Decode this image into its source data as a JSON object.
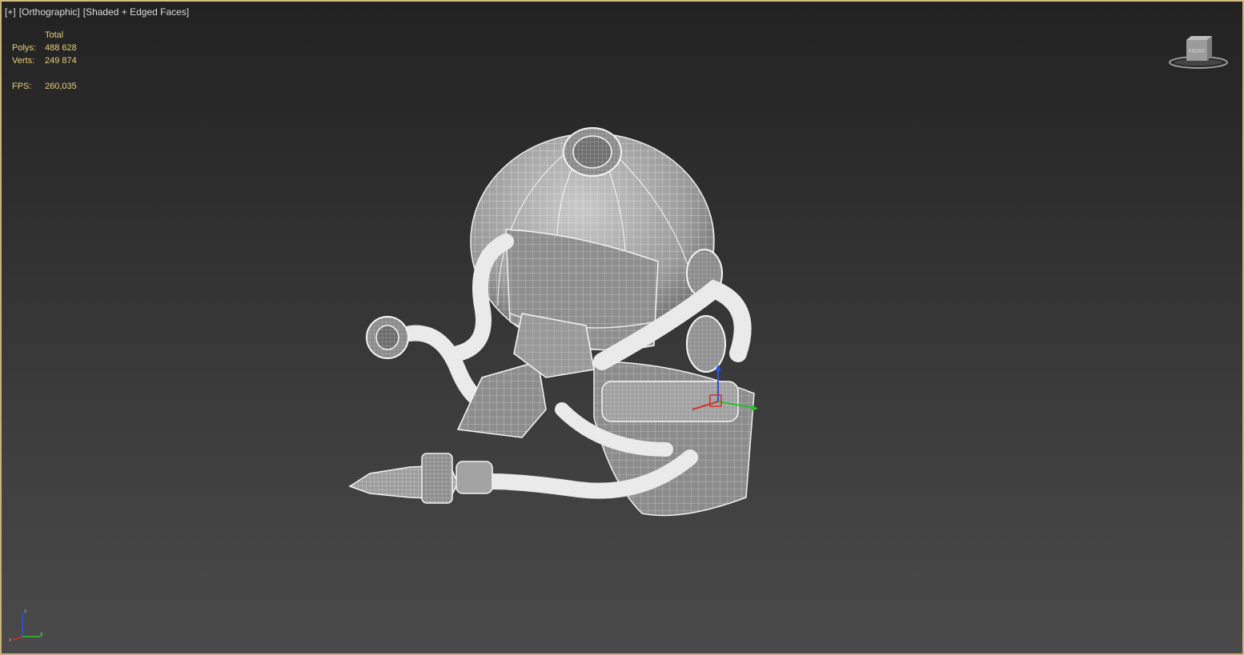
{
  "viewport": {
    "label_parts": [
      "[+]",
      "[Orthographic]",
      "[Shaded + Edged Faces]"
    ],
    "border_color": "#c9b37a"
  },
  "stats": {
    "header": "Total",
    "polys_label": "Polys:",
    "polys_value": "488 628",
    "verts_label": "Verts:",
    "verts_value": "249 874",
    "fps_label": "FPS:",
    "fps_value": "260,035",
    "text_color": "#e8cf7a"
  },
  "viewcube": {
    "face_label": "FRONT"
  },
  "axis_tripod": {
    "x": "x",
    "y": "y",
    "z": "z"
  },
  "colors": {
    "x_axis": "#d23030",
    "y_axis": "#2fbf2f",
    "z_axis": "#3050e0",
    "mesh": "#a8a8a8",
    "wire": "#f2f2f2"
  }
}
